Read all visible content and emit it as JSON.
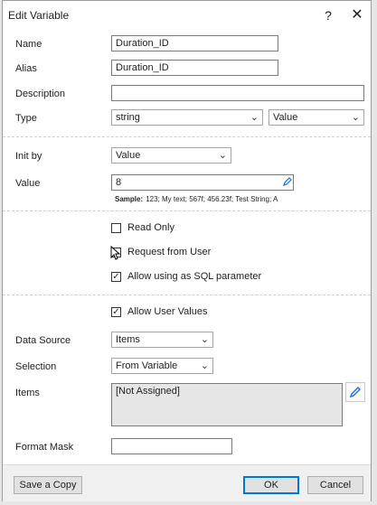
{
  "window": {
    "title": "Edit Variable",
    "help_label": "?",
    "close_label": "✕"
  },
  "fields": {
    "name_label": "Name",
    "name_value": "Duration_ID",
    "alias_label": "Alias",
    "alias_value": "Duration_ID",
    "description_label": "Description",
    "description_value": "",
    "type_label": "Type",
    "type_value": "string",
    "type_kind_value": "Value"
  },
  "init": {
    "init_by_label": "Init by",
    "init_by_value": "Value",
    "value_label": "Value",
    "value_value": "8",
    "sample_label": "Sample:",
    "sample_text": "123; My text; 567f; 456.23f; Test String; A"
  },
  "options": {
    "read_only_label": "Read Only",
    "read_only_checked": false,
    "request_from_user_label": "Request from User",
    "request_from_user_checked": false,
    "allow_sql_label": "Allow using as SQL parameter",
    "allow_sql_checked": true
  },
  "user_values": {
    "allow_user_values_label": "Allow User Values",
    "allow_user_values_checked": true,
    "data_source_label": "Data Source",
    "data_source_value": "Items",
    "selection_label": "Selection",
    "selection_value": "From Variable",
    "items_label": "Items",
    "items_value": "[Not Assigned]",
    "format_mask_label": "Format Mask",
    "format_mask_value": ""
  },
  "buttons": {
    "save_copy": "Save a Copy",
    "ok": "OK",
    "cancel": "Cancel"
  },
  "icons": {
    "chevron": "chevron-down-icon",
    "pencil": "pencil-icon",
    "check": "✓"
  },
  "colors": {
    "accent": "#0078d7",
    "pencil": "#1e6fd9"
  }
}
